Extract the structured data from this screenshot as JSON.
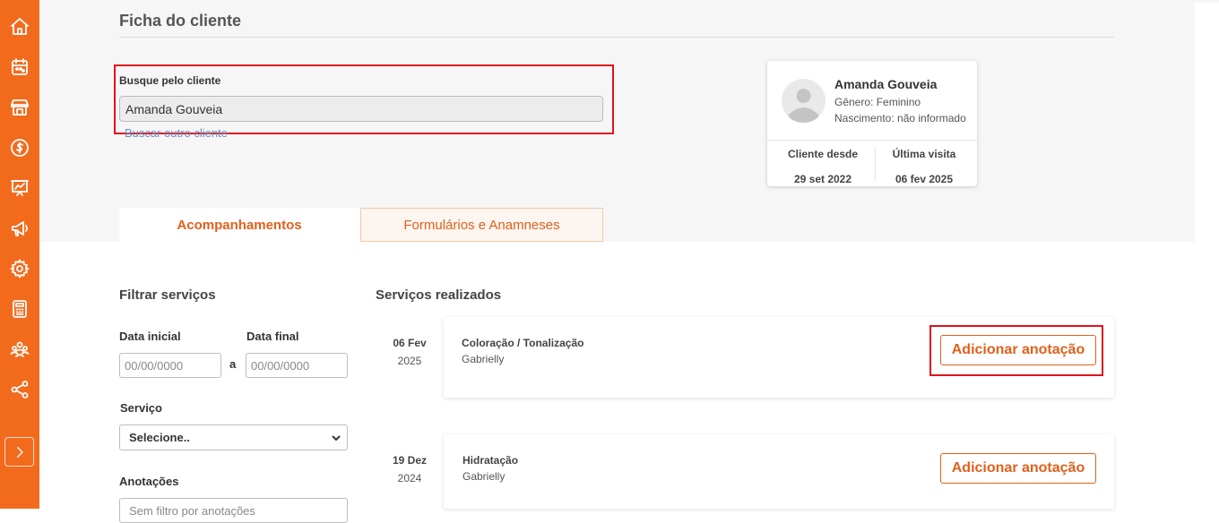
{
  "header": {
    "title": "Ficha do cliente"
  },
  "search": {
    "label": "Busque pelo cliente",
    "value": "Amanda Gouveia",
    "other_link": "Buscar outro cliente"
  },
  "client": {
    "name": "Amanda Gouveia",
    "gender": "Gênero: Feminino",
    "birth": "Nascimento: não informado",
    "since_label": "Cliente desde",
    "since_value": "29 set 2022",
    "last_visit_label": "Última visita",
    "last_visit_value": "06 fev 2025"
  },
  "tabs": [
    {
      "label": "Acompanhamentos",
      "active": true
    },
    {
      "label": "Formulários e Anamneses",
      "active": false
    }
  ],
  "filters": {
    "title": "Filtrar serviços",
    "start_label": "Data inicial",
    "end_label": "Data final",
    "date_placeholder": "00/00/0000",
    "separator": "a",
    "service_label": "Serviço",
    "service_value": "Selecione..",
    "notes_label": "Anotações",
    "notes_value": "Sem filtro por anotações"
  },
  "services": {
    "title": "Serviços realizados",
    "items": [
      {
        "day": "06 Fev",
        "year": "2025",
        "name": "Coloração / Tonalização",
        "professional": "Gabrielly",
        "action": "Adicionar anotação"
      },
      {
        "day": "19 Dez",
        "year": "2024",
        "name": "Hidratação",
        "professional": "Gabrielly",
        "action": "Adicionar anotação"
      }
    ]
  },
  "sidebar": {
    "icons": [
      "home-icon",
      "calendar-icon",
      "store-icon",
      "dollar-icon",
      "presentation-chart-icon",
      "megaphone-icon",
      "gear-icon",
      "calculator-icon",
      "users-icon",
      "share-icon"
    ],
    "expand_icon": "chevron-right-icon"
  },
  "colors": {
    "brand": "#f26b1d",
    "accent": "#e0601c",
    "highlight": "#e0121e"
  }
}
